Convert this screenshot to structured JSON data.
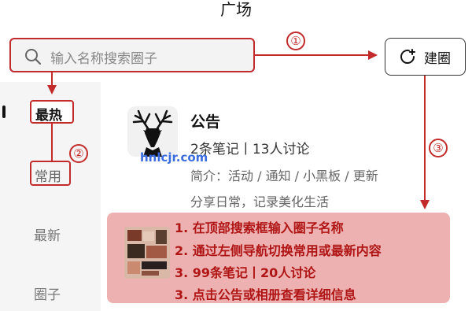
{
  "header": {
    "title": "广场"
  },
  "search": {
    "placeholder": "输入名称搜索圈子"
  },
  "create_button": {
    "label": "建圈"
  },
  "sidebar": {
    "items": [
      {
        "label": "最热"
      },
      {
        "label": "常用"
      },
      {
        "label": "最新"
      },
      {
        "label": "圈子"
      }
    ]
  },
  "post": {
    "title": "公告",
    "stats": "2条笔记丨13人讨论",
    "desc_line1": "简介：活动 / 通知 / 小黑板 / 更新",
    "desc_line2": "分享日常，记录美化生活"
  },
  "watermark": "hnlcjr.com",
  "annotation": {
    "badges": [
      "①",
      "②",
      "③"
    ],
    "steps": [
      "1. 在顶部搜索框输入圈子名称",
      "2. 通过左侧导航切换常用或最新内容",
      "3. 99条笔记丨20人讨论",
      "3. 点击公告或相册查看详细信息"
    ]
  },
  "colors": {
    "annotation_red": "#c32a2a",
    "overlay": "rgba(225,120,120,0.58)",
    "sidebar_bg": "#f5f5f5"
  },
  "icons": {
    "search": "search-icon",
    "create": "refresh-plus-icon",
    "avatar": "deer-icon"
  }
}
